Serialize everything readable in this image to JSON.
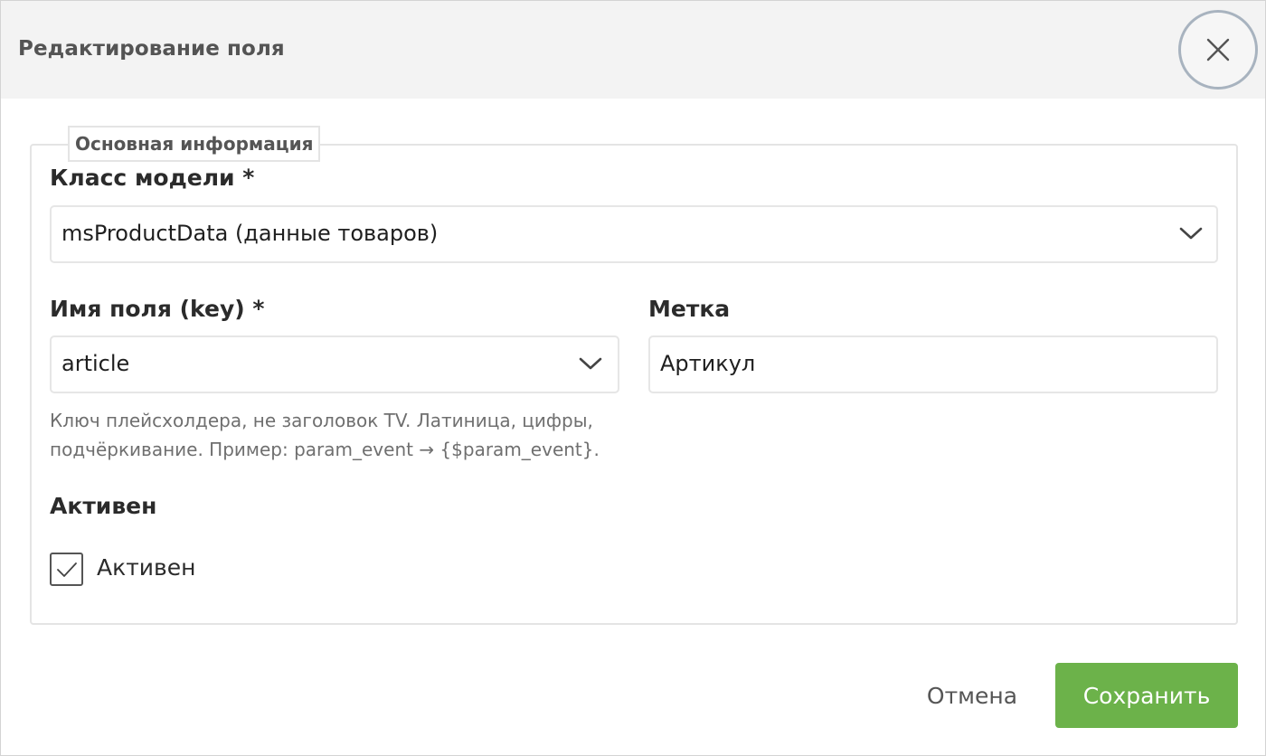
{
  "dialog": {
    "title": "Редактирование поля",
    "close_icon": "close-icon"
  },
  "section": {
    "legend": "Основная информация"
  },
  "fields": {
    "model_class": {
      "label": "Класс модели *",
      "value": "msProductData (данные товаров)",
      "icon": "chevron-down-icon"
    },
    "field_key": {
      "label": "Имя поля (key) *",
      "value": "article",
      "icon": "chevron-down-icon",
      "help_line1": "Ключ плейсхолдера, не заголовок TV. Латиница, цифры,",
      "help_line2": "подчёркивание. Пример: param_event → {$param_event}."
    },
    "label_field": {
      "label": "Метка",
      "value": "Артикул"
    },
    "active": {
      "section_label": "Активен",
      "checkbox_label": "Активен",
      "checked": true,
      "icon": "checkmark-icon"
    }
  },
  "footer": {
    "cancel_label": "Отмена",
    "save_label": "Сохранить"
  },
  "colors": {
    "primary": "#6cb24a",
    "header_bg": "#f3f3f3",
    "close_border": "#a8b3bf"
  }
}
